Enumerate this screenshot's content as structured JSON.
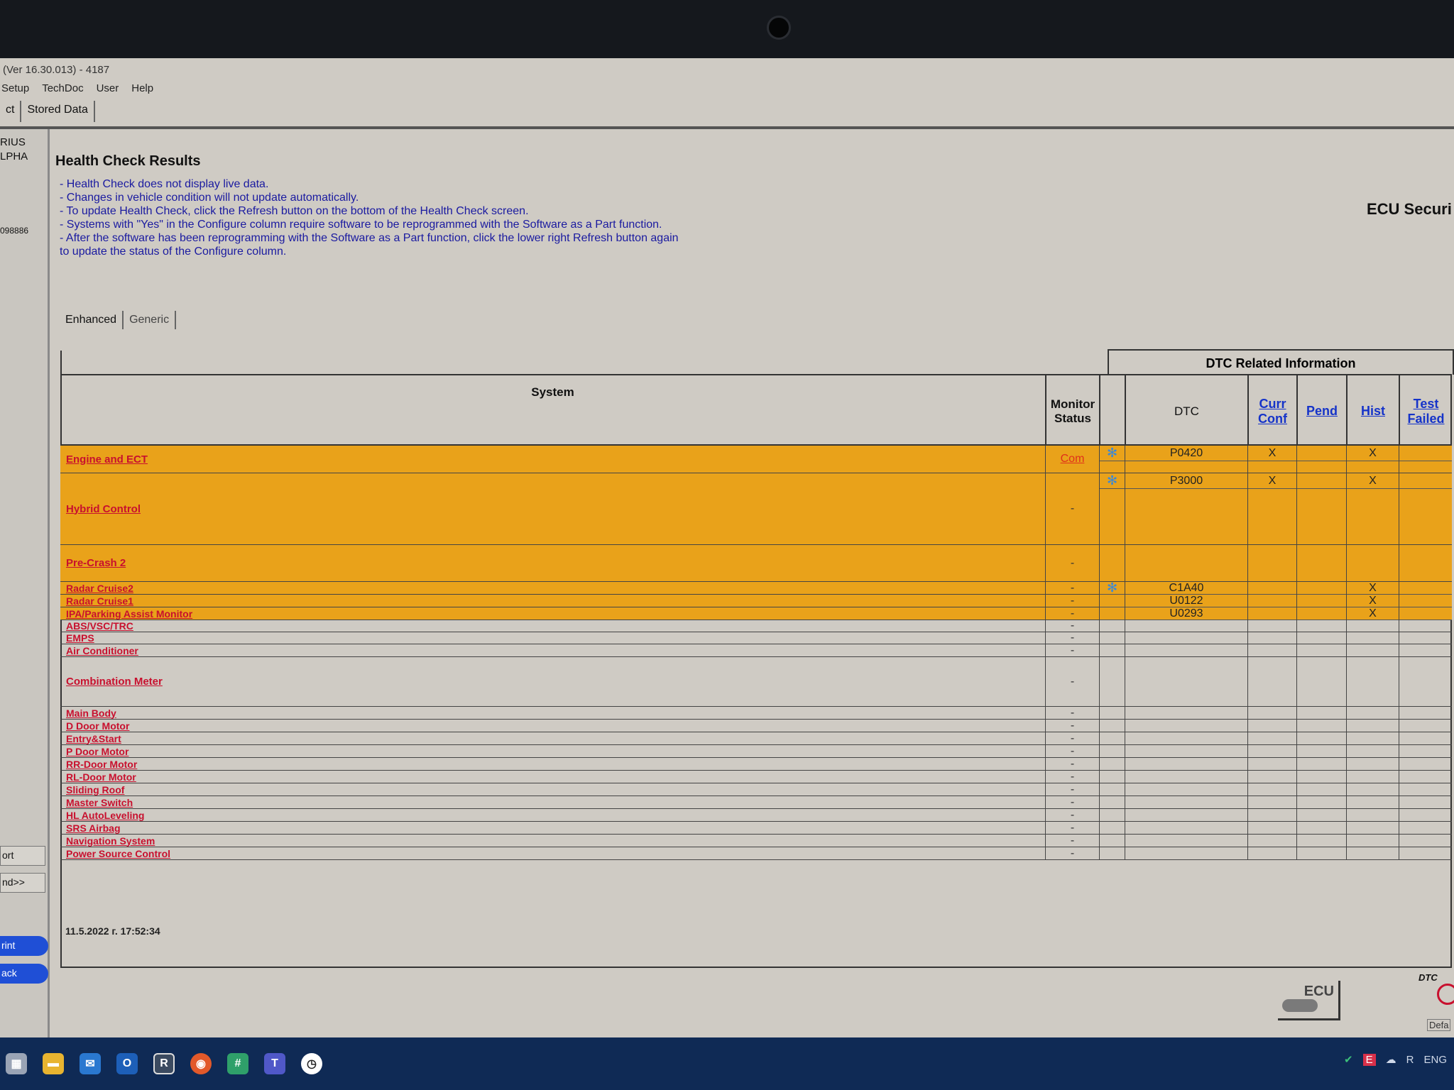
{
  "window": {
    "title": "(Ver 16.30.013) - 4187"
  },
  "menu": [
    "Setup",
    "TechDoc",
    "User",
    "Help"
  ],
  "tabs": {
    "partial": "ct",
    "active": "Stored Data"
  },
  "left_panel": {
    "vehicle_line1": "RIUS",
    "vehicle_line2": "LPHA",
    "vin_fragment": "098886",
    "button_report": "ort",
    "button_expand": "nd>>",
    "button_print": "rint",
    "button_back": "ack",
    "accent_color": "#1f4fd6"
  },
  "main": {
    "heading": "Health Check Results",
    "notes": [
      "- Health Check does not display live data.",
      "- Changes in vehicle condition will not update automatically.",
      "- To update Health Check, click the Refresh button on the bottom of the Health Check screen.",
      "- Systems with \"Yes\" in the Configure column require software to be reprogrammed with the Software as a Part function.",
      "- After the software has been reprogramming with the Software as a Part function, click the lower right Refresh button again",
      "to update the status of the Configure column."
    ],
    "ecu_security": "ECU Securi",
    "subtabs": [
      "Enhanced",
      "Generic"
    ],
    "active_subtab": "Enhanced",
    "timestamp": "11.5.2022 г. 17:52:34"
  },
  "table": {
    "headers": {
      "system": "System",
      "monitor": "Monitor Status",
      "dtc_group": "DTC Related Information",
      "dtc": "DTC",
      "curr_conf": "Curr Conf",
      "pend": "Pend",
      "hist": "Hist",
      "test_failed": "Test Failed"
    },
    "highlight_color": "#e9a21a",
    "rows": [
      {
        "system": "Engine and ECT",
        "monitor": "Com",
        "highlight": true,
        "dtcs": [
          {
            "code": "P0420",
            "curr": "X",
            "pend": "",
            "hist": "X",
            "test": "",
            "icon": true
          }
        ]
      },
      {
        "system": "Hybrid Control",
        "monitor": "-",
        "highlight": true,
        "dtcs": [
          {
            "code": "P3000",
            "curr": "X",
            "pend": "",
            "hist": "X",
            "test": "",
            "icon": true
          }
        ]
      },
      {
        "system": "Pre-Crash 2",
        "monitor": "-",
        "highlight": true,
        "dtcs": []
      },
      {
        "system": "Radar Cruise2",
        "monitor": "-",
        "highlight": true,
        "dtcs": [
          {
            "code": "C1A40",
            "curr": "",
            "pend": "",
            "hist": "X",
            "test": "",
            "icon": true
          }
        ]
      },
      {
        "system": "Radar Cruise1",
        "monitor": "-",
        "highlight": true,
        "dtcs": [
          {
            "code": "U0122",
            "curr": "",
            "pend": "",
            "hist": "X",
            "test": ""
          }
        ]
      },
      {
        "system": "IPA/Parking Assist Monitor",
        "monitor": "-",
        "highlight": true,
        "dtcs": [
          {
            "code": "U0293",
            "curr": "",
            "pend": "",
            "hist": "X",
            "test": ""
          }
        ]
      },
      {
        "system": "ABS/VSC/TRC",
        "monitor": "-",
        "dtcs": []
      },
      {
        "system": "EMPS",
        "monitor": "-",
        "dtcs": []
      },
      {
        "system": "Air Conditioner",
        "monitor": "-",
        "dtcs": []
      },
      {
        "system": "Combination Meter",
        "monitor": "-",
        "dtcs": []
      },
      {
        "system": "Main Body",
        "monitor": "-",
        "dtcs": []
      },
      {
        "system": "D Door Motor",
        "monitor": "-",
        "dtcs": []
      },
      {
        "system": "Entry&Start",
        "monitor": "-",
        "dtcs": []
      },
      {
        "system": "P Door Motor",
        "monitor": "-",
        "dtcs": []
      },
      {
        "system": "RR-Door Motor",
        "monitor": "-",
        "dtcs": []
      },
      {
        "system": "RL-Door Motor",
        "monitor": "-",
        "dtcs": []
      },
      {
        "system": "Sliding Roof",
        "monitor": "-",
        "dtcs": []
      },
      {
        "system": "Master Switch",
        "monitor": "-",
        "dtcs": []
      },
      {
        "system": "HL AutoLeveling",
        "monitor": "-",
        "dtcs": []
      },
      {
        "system": "SRS Airbag",
        "monitor": "-",
        "dtcs": []
      },
      {
        "system": "Navigation System",
        "monitor": "-",
        "dtcs": []
      },
      {
        "system": "Power Source Control",
        "monitor": "-",
        "dtcs": []
      }
    ]
  },
  "bottom_buttons": {
    "ecu": "ECU",
    "dtc": "DTC",
    "default": "Defa"
  },
  "taskbar": {
    "icons": [
      "start-icon",
      "folder-icon",
      "mail-icon",
      "outlook-icon",
      "r-app-icon",
      "firefox-icon",
      "slack-icon",
      "teams-icon",
      "clock-icon"
    ],
    "language": "ENG"
  }
}
